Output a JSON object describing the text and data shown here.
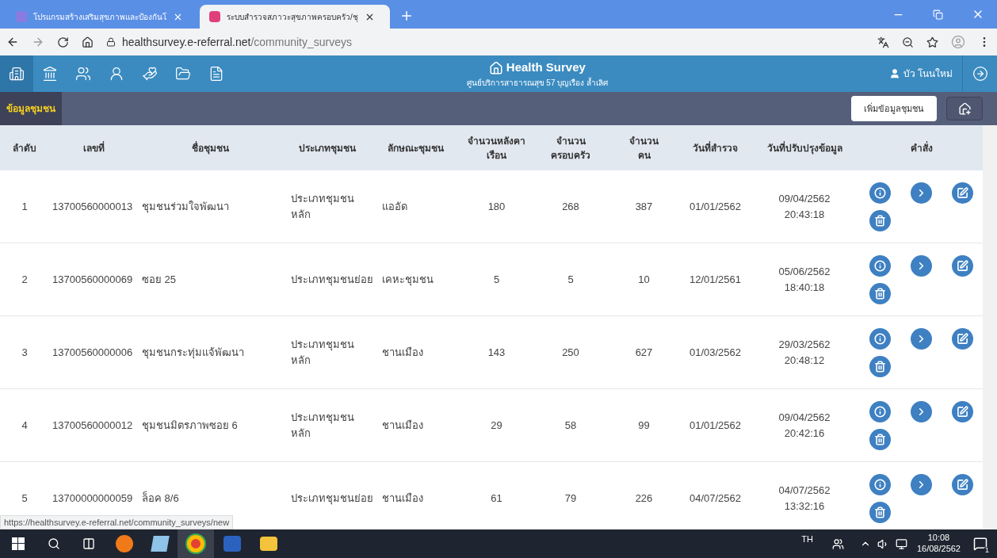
{
  "browser": {
    "tabs": [
      {
        "title": "โปรแกรมสร้างเสริมสุขภาพและป้องกันโ",
        "selected": false
      },
      {
        "title": "ระบบสำรวจสภาวะสุขภาพครอบครัว/ชุ",
        "selected": true
      }
    ],
    "url_host": "healthsurvey.e-referral.net",
    "url_path": "/community_surveys"
  },
  "app": {
    "title": "Health Survey",
    "subtitle": "ศูนย์บริการสาธารณสุข 57 บุญเรือง ล้ำเลิศ",
    "user": "บัว โนนใหม่",
    "nav": [
      {
        "selected": true
      },
      {
        "selected": false
      },
      {
        "selected": false
      },
      {
        "selected": false
      },
      {
        "selected": false
      },
      {
        "selected": false
      },
      {
        "selected": false
      }
    ]
  },
  "section": {
    "title": "ข้อมูลชุมชน",
    "add_tooltip": "เพิ่มข้อมูลชุมชน"
  },
  "table": {
    "columns": [
      [
        "ลำดับ"
      ],
      [
        "เลขที่"
      ],
      [
        "ชื่อชุมชน"
      ],
      [
        "ประเภทชุมชน"
      ],
      [
        "ลักษณะชุมชน"
      ],
      [
        "จำนวนหลังคา",
        "เรือน"
      ],
      [
        "จำนวน",
        "ครอบครัว"
      ],
      [
        "จำนวน",
        "คน"
      ],
      [
        "วันที่สำรวจ"
      ],
      [
        "วันที่ปรับปรุงข้อมูล"
      ],
      [
        "คำสั่ง"
      ]
    ],
    "rows": [
      {
        "no": "1",
        "code": "13700560000013",
        "name": "ชุมชนร่วมใจพัฒนา",
        "type": [
          "ประเภทชุมชน",
          "หลัก"
        ],
        "character": "แออัด",
        "houses": "180",
        "families": "268",
        "people": "387",
        "surveyed": "01/01/2562",
        "updated": [
          "09/04/2562",
          "20:43:18"
        ]
      },
      {
        "no": "2",
        "code": "13700560000069",
        "name": "ซอย 25",
        "type": [
          "ประเภทชุมชนย่อย"
        ],
        "character": "เคหะชุมชน",
        "houses": "5",
        "families": "5",
        "people": "10",
        "surveyed": "12/01/2561",
        "updated": [
          "05/06/2562",
          "18:40:18"
        ]
      },
      {
        "no": "3",
        "code": "13700560000006",
        "name": "ชุมชนกระทุ่มแจ้พัฒนา",
        "type": [
          "ประเภทชุมชน",
          "หลัก"
        ],
        "character": "ชานเมือง",
        "houses": "143",
        "families": "250",
        "people": "627",
        "surveyed": "01/03/2562",
        "updated": [
          "29/03/2562",
          "20:48:12"
        ]
      },
      {
        "no": "4",
        "code": "13700560000012",
        "name": "ชุมชนมิตรภาพซอย 6",
        "type": [
          "ประเภทชุมชน",
          "หลัก"
        ],
        "character": "ชานเมือง",
        "houses": "29",
        "families": "58",
        "people": "99",
        "surveyed": "01/01/2562",
        "updated": [
          "09/04/2562",
          "20:42:16"
        ]
      },
      {
        "no": "5",
        "code": "13700000000059",
        "name": "ล็อค 8/6",
        "type": [
          "ประเภทชุมชนย่อย"
        ],
        "character": "ชานเมือง",
        "houses": "61",
        "families": "79",
        "people": "226",
        "surveyed": "04/07/2562",
        "updated": [
          "04/07/2562",
          "13:32:16"
        ]
      }
    ]
  },
  "status_url": "https://healthsurvey.e-referral.net/community_surveys/new",
  "taskbar": {
    "language": "TH",
    "time": "10:08",
    "date": "16/08/2562",
    "notifications": "1"
  }
}
